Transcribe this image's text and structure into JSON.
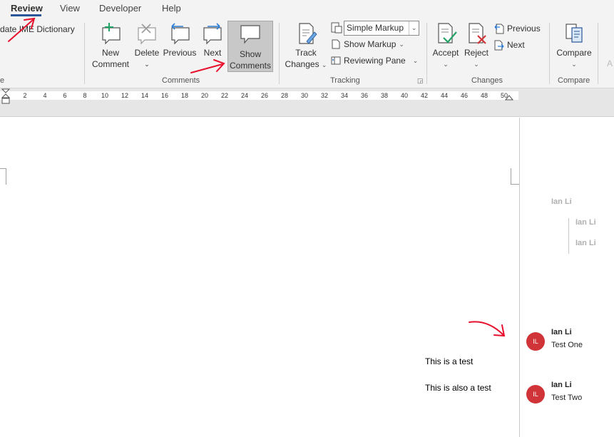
{
  "tabs": {
    "review": "Review",
    "view": "View",
    "developer": "Developer",
    "help": "Help"
  },
  "ribbon": {
    "update_dictionary": "date IME Dictionary",
    "left_group_fragment": "e",
    "comments_group": {
      "label": "Comments",
      "new_comment": [
        "New",
        "Comment"
      ],
      "delete": "Delete",
      "previous": "Previous",
      "next": "Next",
      "show_comments": [
        "Show",
        "Comments"
      ]
    },
    "tracking_group": {
      "label": "Tracking",
      "track_changes": [
        "Track",
        "Changes"
      ],
      "markup_select": "Simple Markup",
      "show_markup": "Show Markup",
      "reviewing_pane": "Reviewing Pane"
    },
    "changes_group": {
      "label": "Changes",
      "accept": "Accept",
      "reject": "Reject",
      "previous": "Previous",
      "next": "Next"
    },
    "compare_group": {
      "label": "Compare",
      "compare": "Compare"
    },
    "cut_off": "A"
  },
  "ruler": {
    "ticks": [
      "2",
      "4",
      "6",
      "8",
      "10",
      "12",
      "14",
      "16",
      "18",
      "20",
      "22",
      "24",
      "26",
      "28",
      "30",
      "32",
      "34",
      "36",
      "38",
      "40",
      "42",
      "44",
      "46",
      "48",
      "50"
    ]
  },
  "document": {
    "line1": "This is a test",
    "line2": "This is also a test"
  },
  "markup_pane": {
    "faded_authors": [
      "Ian Li",
      "Ian Li",
      "Ian Li"
    ],
    "comments": [
      {
        "initials": "IL",
        "author": "Ian Li",
        "text": "Test One"
      },
      {
        "initials": "IL",
        "author": "Ian Li",
        "text": "Test Two"
      }
    ]
  },
  "colors": {
    "accent": "#2b579a",
    "annotation_red": "#e8112d",
    "avatar": "#d13438"
  }
}
